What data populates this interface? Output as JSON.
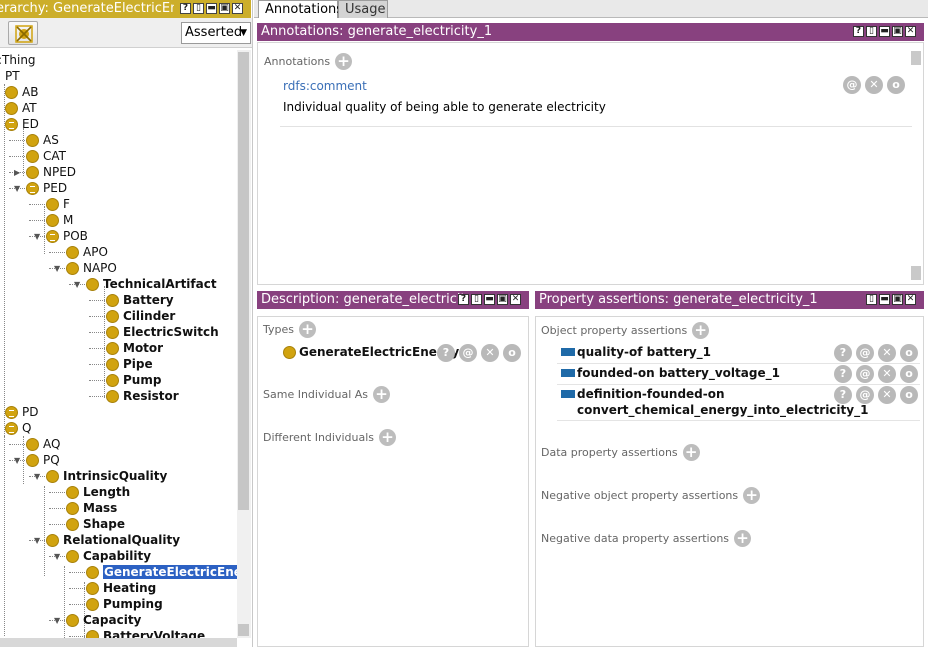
{
  "left_panel": {
    "title": "erarchy: GenerateElectricEne",
    "asserted_label": "Asserted",
    "toolbar_icon": "remove-class-icon",
    "window_buttons": [
      "?",
      "▯",
      "▬",
      "▣",
      "✕"
    ],
    "tree": [
      {
        "label": ":Thing",
        "bold": false,
        "dot": false
      },
      {
        "label": "PT",
        "bold": false,
        "dot": false
      },
      {
        "label": "AB",
        "bold": false,
        "dot": true
      },
      {
        "label": "AT",
        "bold": false,
        "dot": true
      },
      {
        "label": "ED",
        "bold": false,
        "dot": true
      },
      {
        "label": "AS",
        "bold": false,
        "dot": true
      },
      {
        "label": "CAT",
        "bold": false,
        "dot": true
      },
      {
        "label": "NPED",
        "bold": false,
        "dot": true
      },
      {
        "label": "PED",
        "bold": false,
        "dot": true
      },
      {
        "label": "F",
        "bold": false,
        "dot": true
      },
      {
        "label": "M",
        "bold": false,
        "dot": true
      },
      {
        "label": "POB",
        "bold": false,
        "dot": true
      },
      {
        "label": "APO",
        "bold": false,
        "dot": true
      },
      {
        "label": "NAPO",
        "bold": false,
        "dot": true
      },
      {
        "label": "TechnicalArtifact",
        "bold": true,
        "dot": true
      },
      {
        "label": "Battery",
        "bold": true,
        "dot": true
      },
      {
        "label": "Cilinder",
        "bold": true,
        "dot": true
      },
      {
        "label": "ElectricSwitch",
        "bold": true,
        "dot": true
      },
      {
        "label": "Motor",
        "bold": true,
        "dot": true
      },
      {
        "label": "Pipe",
        "bold": true,
        "dot": true
      },
      {
        "label": "Pump",
        "bold": true,
        "dot": true
      },
      {
        "label": "Resistor",
        "bold": true,
        "dot": true
      },
      {
        "label": "PD",
        "bold": false,
        "dot": true
      },
      {
        "label": "Q",
        "bold": false,
        "dot": true
      },
      {
        "label": "AQ",
        "bold": false,
        "dot": true
      },
      {
        "label": "PQ",
        "bold": false,
        "dot": true
      },
      {
        "label": "IntrinsicQuality",
        "bold": true,
        "dot": true
      },
      {
        "label": "Length",
        "bold": true,
        "dot": true
      },
      {
        "label": "Mass",
        "bold": true,
        "dot": true
      },
      {
        "label": "Shape",
        "bold": true,
        "dot": true
      },
      {
        "label": "RelationalQuality",
        "bold": true,
        "dot": true
      },
      {
        "label": "Capability",
        "bold": true,
        "dot": true
      },
      {
        "label": "GenerateElectricEnergy",
        "bold": true,
        "dot": true,
        "selected": true
      },
      {
        "label": "Heating",
        "bold": true,
        "dot": true
      },
      {
        "label": "Pumping",
        "bold": true,
        "dot": true
      },
      {
        "label": "Capacity",
        "bold": true,
        "dot": true
      },
      {
        "label": "BatteryVoltage",
        "bold": true,
        "dot": true
      }
    ]
  },
  "tabs": [
    {
      "label": "Annotations",
      "active": true
    },
    {
      "label": "Usage",
      "active": false
    }
  ],
  "annotations_panel": {
    "title": "Annotations: generate_electricity_1",
    "section_label": "Annotations",
    "property": "rdfs:comment",
    "value": "Individual quality of being able to generate electricity"
  },
  "description_panel": {
    "title": "Description: generate_electricit",
    "types_label": "Types",
    "type_value": "GenerateElectricEnergy",
    "same_label": "Same Individual As",
    "different_label": "Different Individuals"
  },
  "property_panel": {
    "title": "Property assertions: generate_electricity_1",
    "object_label": "Object property assertions",
    "assertions": [
      {
        "text": "quality-of  battery_1"
      },
      {
        "text": "founded-on  battery_voltage_1"
      },
      {
        "text": "definition-founded-on",
        "text2": "convert_chemical_energy_into_electricity_1"
      }
    ],
    "data_label": "Data property assertions",
    "neg_object_label": "Negative object property assertions",
    "neg_data_label": "Negative data property assertions"
  },
  "action_glyphs": {
    "info": "?",
    "annotate": "@",
    "delete": "✕",
    "edit": "o"
  },
  "colors": {
    "hierarchy_header": "#ccae2a",
    "view_header": "#88417f",
    "class_dot": "#d1a30f",
    "object_property": "#1f6aa8",
    "selection": "#2c61c3"
  }
}
